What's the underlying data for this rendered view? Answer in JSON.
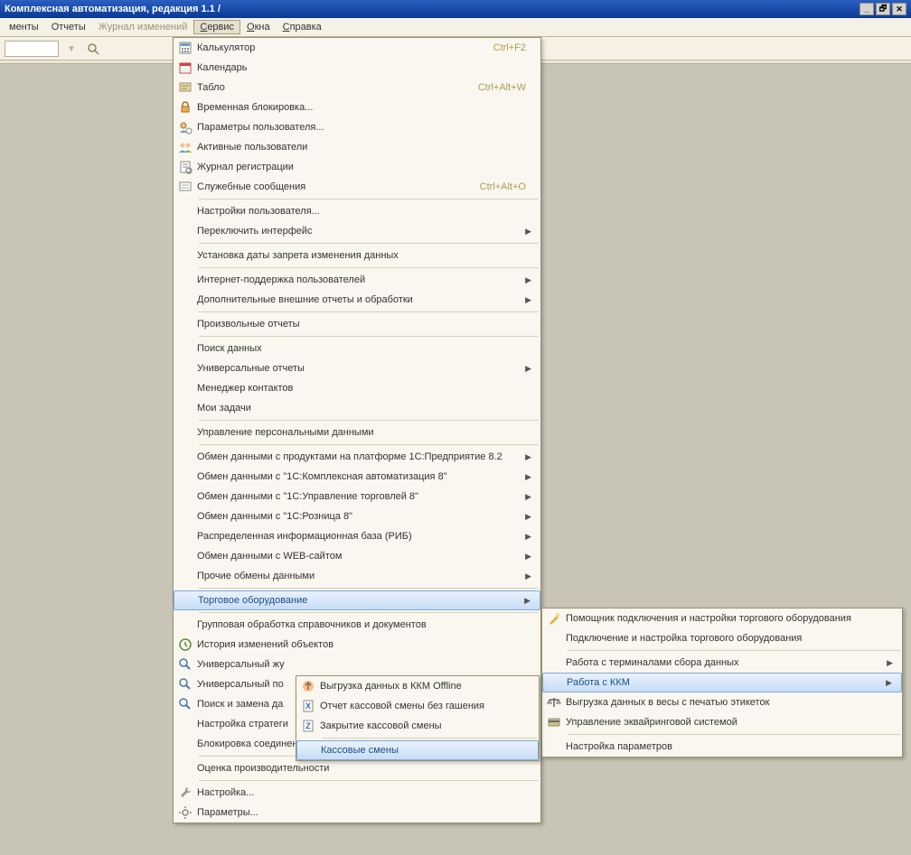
{
  "titlebar": {
    "title": "Комплексная автоматизация, редакция 1.1 /"
  },
  "win_buttons": {
    "min": "_",
    "max": "🗗",
    "close": "✕"
  },
  "menubar": {
    "items": [
      "менты",
      "Отчеты",
      "Журнал изменений",
      "Сервис",
      "Окна",
      "Справка"
    ],
    "open_index": 3,
    "muted_index": 2
  },
  "dropdown_main": [
    {
      "type": "item",
      "icon": "calculator-icon",
      "label": "Калькулятор",
      "shortcut": "Ctrl+F2"
    },
    {
      "type": "item",
      "icon": "calendar-icon",
      "label": "Календарь"
    },
    {
      "type": "item",
      "icon": "board-icon",
      "label": "Табло",
      "shortcut": "Ctrl+Alt+W"
    },
    {
      "type": "item",
      "icon": "lock-icon",
      "label": "Временная блокировка..."
    },
    {
      "type": "item",
      "icon": "user-params-icon",
      "label": "Параметры пользователя..."
    },
    {
      "type": "item",
      "icon": "users-icon",
      "label": "Активные пользователи"
    },
    {
      "type": "item",
      "icon": "journal-icon",
      "label": "Журнал регистрации"
    },
    {
      "type": "item",
      "icon": "messages-icon",
      "label": "Служебные сообщения",
      "shortcut": "Ctrl+Alt+O"
    },
    {
      "type": "sep"
    },
    {
      "type": "item",
      "label": "Настройки пользователя..."
    },
    {
      "type": "item",
      "label": "Переключить интерфейс",
      "arrow": true
    },
    {
      "type": "sep"
    },
    {
      "type": "item",
      "label": "Установка даты запрета изменения данных"
    },
    {
      "type": "sep"
    },
    {
      "type": "item",
      "label": "Интернет-поддержка пользователей",
      "arrow": true
    },
    {
      "type": "item",
      "label": "Дополнительные внешние отчеты и обработки",
      "arrow": true
    },
    {
      "type": "sep"
    },
    {
      "type": "item",
      "label": "Произвольные отчеты"
    },
    {
      "type": "sep"
    },
    {
      "type": "item",
      "label": "Поиск данных"
    },
    {
      "type": "item",
      "label": "Универсальные отчеты",
      "arrow": true
    },
    {
      "type": "item",
      "label": "Менеджер контактов"
    },
    {
      "type": "item",
      "label": "Мои задачи"
    },
    {
      "type": "sep"
    },
    {
      "type": "item",
      "label": "Управление персональными данными"
    },
    {
      "type": "sep"
    },
    {
      "type": "item",
      "label": "Обмен данными с продуктами на платформе 1С:Предприятие 8.2",
      "arrow": true
    },
    {
      "type": "item",
      "label": "Обмен данными с \"1С:Комплексная автоматизация 8\"",
      "arrow": true
    },
    {
      "type": "item",
      "label": "Обмен данными с \"1С:Управление торговлей 8\"",
      "arrow": true
    },
    {
      "type": "item",
      "label": "Обмен данными с \"1С:Розница 8\"",
      "arrow": true
    },
    {
      "type": "item",
      "label": "Распределенная информационная база (РИБ)",
      "arrow": true
    },
    {
      "type": "item",
      "label": "Обмен данными с WEB-сайтом",
      "arrow": true
    },
    {
      "type": "item",
      "label": "Прочие обмены данными",
      "arrow": true
    },
    {
      "type": "sep"
    },
    {
      "type": "item",
      "label": "Торговое оборудование",
      "arrow": true,
      "highlight": true
    },
    {
      "type": "sep"
    },
    {
      "type": "item",
      "label": "Групповая обработка справочников и документов"
    },
    {
      "type": "item",
      "icon": "history-icon",
      "label": "История изменений объектов"
    },
    {
      "type": "item",
      "icon": "search-icon",
      "label": "Универсальный жу"
    },
    {
      "type": "item",
      "icon": "search-icon",
      "label": "Универсальный по"
    },
    {
      "type": "item",
      "icon": "search-icon",
      "label": "Поиск и замена да"
    },
    {
      "type": "item",
      "label": "Настройка стратеги"
    },
    {
      "type": "item",
      "label": "Блокировка соединении с информационнои базои"
    },
    {
      "type": "sep"
    },
    {
      "type": "item",
      "label": "Оценка производительности"
    },
    {
      "type": "sep"
    },
    {
      "type": "item",
      "icon": "wrench-icon",
      "label": "Настройка..."
    },
    {
      "type": "item",
      "icon": "settings-icon",
      "label": "Параметры..."
    }
  ],
  "sub_right": [
    {
      "icon": "wizard-icon",
      "label": "Помощник подключения и настройки торгового оборудования"
    },
    {
      "label": "Подключение и настройка торгового оборудования"
    },
    {
      "type": "sep"
    },
    {
      "label": "Работа с терминалами сбора данных",
      "arrow": true
    },
    {
      "label": "Работа с ККМ",
      "arrow": true,
      "highlight": true
    },
    {
      "icon": "scales-icon",
      "label": "Выгрузка данных в весы с печатью этикеток"
    },
    {
      "icon": "acquiring-icon",
      "label": "Управление эквайринговой системой"
    },
    {
      "type": "sep"
    },
    {
      "label": "Настройка параметров"
    }
  ],
  "sub_nested": [
    {
      "icon": "upload-icon",
      "label": "Выгрузка данных в ККМ Offline"
    },
    {
      "icon": "x-report-icon",
      "label": "Отчет кассовой смены без гашения"
    },
    {
      "icon": "z-report-icon",
      "label": "Закрытие кассовой смены"
    },
    {
      "type": "sep"
    },
    {
      "label": "Кассовые смены",
      "highlight": true
    }
  ]
}
